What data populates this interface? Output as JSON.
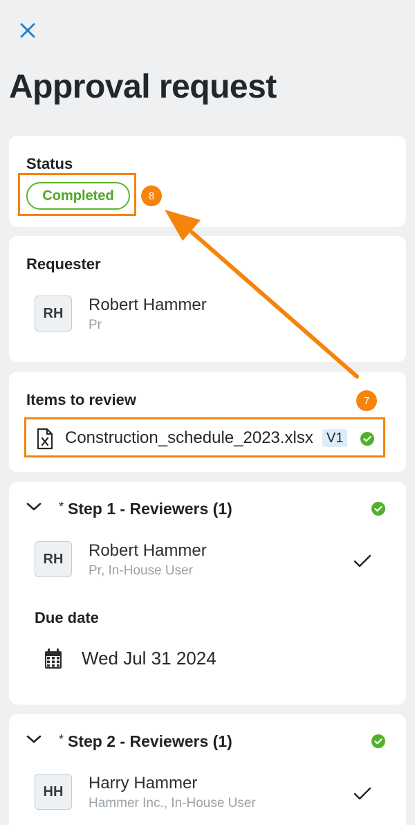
{
  "header": {
    "title": "Approval request"
  },
  "status": {
    "label": "Status",
    "value": "Completed"
  },
  "requester": {
    "label": "Requester",
    "initials": "RH",
    "name": "Robert Hammer",
    "subtitle": "Pr"
  },
  "items": {
    "label": "Items to review",
    "file_name": "Construction_schedule_2023.xlsx",
    "version": "V1"
  },
  "annotations": {
    "marker_8": "8",
    "marker_7": "7"
  },
  "steps": [
    {
      "title": "Step 1 - Reviewers (1)",
      "required_mark": "*",
      "reviewer": {
        "initials": "RH",
        "name": "Robert Hammer",
        "subtitle": "Pr, In-House User"
      },
      "due_label": "Due date",
      "due_value": "Wed Jul 31 2024"
    },
    {
      "title": "Step 2 - Reviewers (1)",
      "required_mark": "*",
      "reviewer": {
        "initials": "HH",
        "name": "Harry Hammer",
        "subtitle": "Hammer Inc., In-House User"
      }
    }
  ],
  "colors": {
    "accent": "#1f7ec5",
    "success": "#52b02a",
    "annotation": "#f5840c",
    "background": "#eef0f2"
  },
  "icons": {
    "close": "close-icon",
    "file": "excel-file-icon",
    "calendar": "calendar-icon",
    "check": "check-circle-icon",
    "chevron": "chevron-down-icon",
    "tick": "checkmark-icon"
  }
}
